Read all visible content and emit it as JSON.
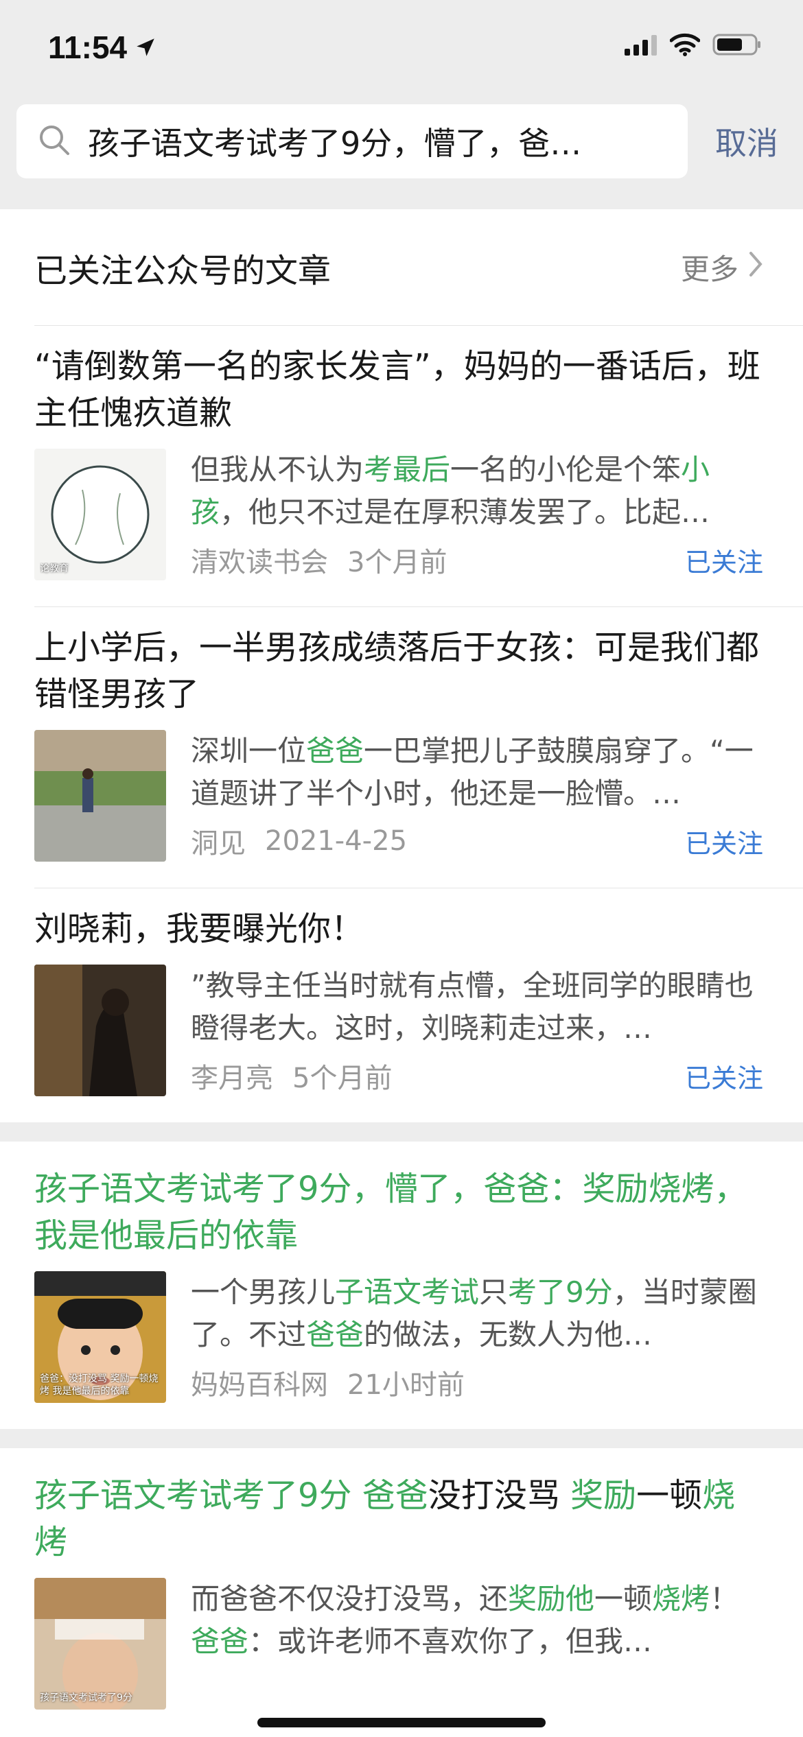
{
  "status_bar": {
    "time": "11:54"
  },
  "search": {
    "query": "孩子语文考试考了9分，懵了，爸…",
    "cancel_label": "取消"
  },
  "section": {
    "title": "已关注公众号的文章",
    "more_label": "更多"
  },
  "followed_articles": [
    {
      "title": "“请倒数第一名的家长发言”，妈妈的一番话后，班主任愧疚道歉",
      "snippet_parts": [
        {
          "text": "但我从不认为",
          "hl": false
        },
        {
          "text": "考最后",
          "hl": true
        },
        {
          "text": "一名的小伦是个笨",
          "hl": false
        },
        {
          "text": "小孩",
          "hl": true
        },
        {
          "text": "，他只不过是在厚积薄发罢了。比起…",
          "hl": false
        }
      ],
      "source": "清欢读书会",
      "date": "3个月前",
      "followed_label": "已关注",
      "thumb": "logo-jiaoyu",
      "thumb_text": "论教育"
    },
    {
      "title": "上小学后，一半男孩成绩落后于女孩：可是我们都错怪男孩了",
      "snippet_parts": [
        {
          "text": "深圳一位",
          "hl": false
        },
        {
          "text": "爸爸",
          "hl": true
        },
        {
          "text": "一巴掌把儿子鼓膜扇穿了。“一道题讲了半个小时，他还是一脸懵。…",
          "hl": false
        }
      ],
      "source": "洞见",
      "date": "2021-4-25",
      "followed_label": "已关注",
      "thumb": "photo-boy-walking"
    },
    {
      "title": "刘晓莉，我要曝光你！",
      "snippet_parts": [
        {
          "text": "”教导主任当时就有点懵，全班同学的眼睛也瞪得老大。这时，刘晓莉走过来，…",
          "hl": false
        }
      ],
      "source": "李月亮",
      "date": "5个月前",
      "followed_label": "已关注",
      "thumb": "photo-woman-dark"
    }
  ],
  "other_articles": [
    {
      "title_parts": [
        {
          "text": "孩子语文考试考了9分，懵了，爸爸：奖励烧烤，我是他最后的依靠",
          "hl": true
        }
      ],
      "snippet_parts": [
        {
          "text": "一个男孩儿",
          "hl": false
        },
        {
          "text": "子语文考试",
          "hl": true
        },
        {
          "text": "只",
          "hl": false
        },
        {
          "text": "考了9分",
          "hl": true
        },
        {
          "text": "，当时蒙圈了。不过",
          "hl": false
        },
        {
          "text": "爸爸",
          "hl": true
        },
        {
          "text": "的做法，无数人为他…",
          "hl": false
        }
      ],
      "source": "妈妈百科网",
      "date": "21小时前",
      "thumb": "photo-boy-face",
      "thumb_text": "爸爸：没打没骂 奖励一顿烧烤 我是他最后的依靠"
    },
    {
      "title_parts": [
        {
          "text": "孩子语文考试考了9分 ",
          "hl": true
        },
        {
          "text": "爸爸",
          "hl": true
        },
        {
          "text": "没打没骂 ",
          "hl": false
        },
        {
          "text": "奖励",
          "hl": true
        },
        {
          "text": "一顿",
          "hl": false
        },
        {
          "text": "烧烤",
          "hl": true
        }
      ],
      "snippet_parts": [
        {
          "text": "而爸爸不仅没打没骂，还",
          "hl": false
        },
        {
          "text": "奖励他",
          "hl": true
        },
        {
          "text": "一顿",
          "hl": false
        },
        {
          "text": "烧烤",
          "hl": true
        },
        {
          "text": "！",
          "hl": false
        },
        {
          "text": "爸爸",
          "hl": true
        },
        {
          "text": "：或许老师不喜欢你了，但我…",
          "hl": false
        }
      ],
      "thumb": "photo-kid-store",
      "thumb_text": "孩子语文考试考了9分"
    }
  ],
  "colors": {
    "highlight": "#3eaa5c",
    "link_blue": "#576b95",
    "followed_blue": "#3a7bd5"
  }
}
